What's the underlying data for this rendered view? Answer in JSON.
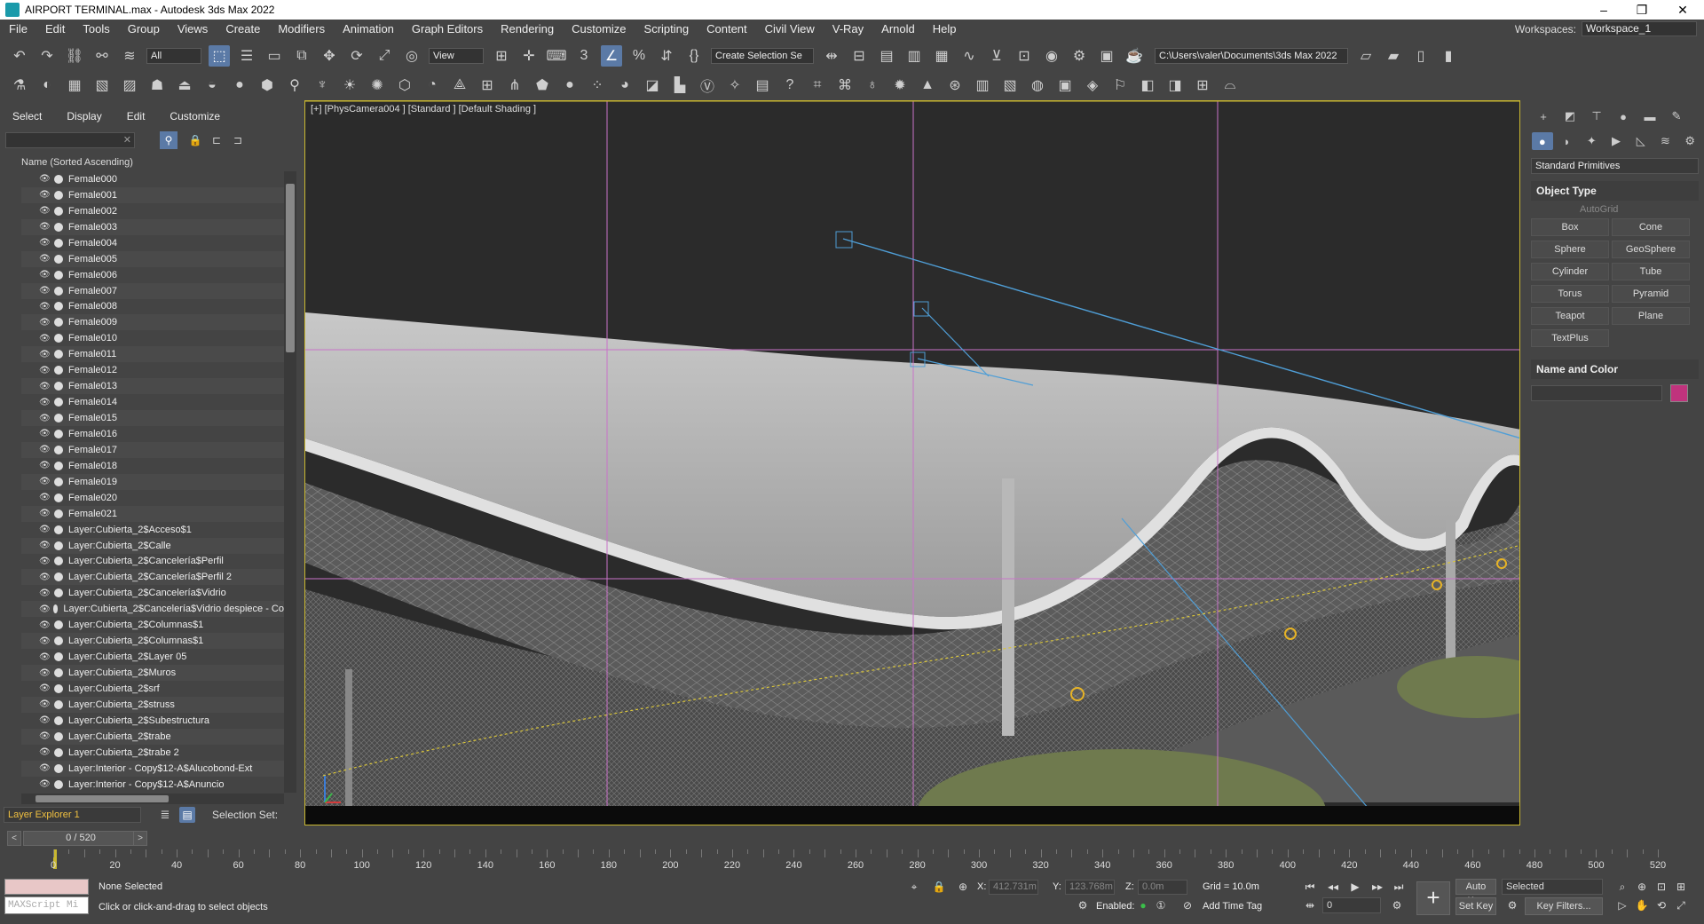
{
  "window": {
    "title": "AIRPORT TERMINAL.max - Autodesk 3ds Max 2022",
    "minimize": "–",
    "maximize": "❐",
    "close": "✕"
  },
  "menu": {
    "items": [
      "File",
      "Edit",
      "Tools",
      "Group",
      "Views",
      "Create",
      "Modifiers",
      "Animation",
      "Graph Editors",
      "Rendering",
      "Customize",
      "Scripting",
      "Content",
      "Civil View",
      "V-Ray",
      "Arnold",
      "Help"
    ],
    "workspace_label": "Workspaces:",
    "workspace_value": "Workspace_1"
  },
  "toolbar": {
    "selection_filter": "All",
    "ref_coord": "View",
    "named_selection": "Create Selection Se",
    "project_path": "C:\\Users\\valer\\Documents\\3ds Max 2022"
  },
  "scene_explorer": {
    "tabs": [
      "Select",
      "Display",
      "Edit",
      "Customize"
    ],
    "column_header": "Name (Sorted Ascending)",
    "rows": [
      "Female000",
      "Female001",
      "Female002",
      "Female003",
      "Female004",
      "Female005",
      "Female006",
      "Female007",
      "Female008",
      "Female009",
      "Female010",
      "Female011",
      "Female012",
      "Female013",
      "Female014",
      "Female015",
      "Female016",
      "Female017",
      "Female018",
      "Female019",
      "Female020",
      "Female021",
      "Layer:Cubierta_2$Acceso$1",
      "Layer:Cubierta_2$Calle",
      "Layer:Cubierta_2$Cancelería$Perfil",
      "Layer:Cubierta_2$Cancelería$Perfil 2",
      "Layer:Cubierta_2$Cancelería$Vidrio",
      "Layer:Cubierta_2$Cancelería$Vidrio despiece - Co",
      "Layer:Cubierta_2$Columnas$1",
      "Layer:Cubierta_2$Columnas$1",
      "Layer:Cubierta_2$Layer 05",
      "Layer:Cubierta_2$Muros",
      "Layer:Cubierta_2$srf",
      "Layer:Cubierta_2$struss",
      "Layer:Cubierta_2$Subestructura",
      "Layer:Cubierta_2$trabe",
      "Layer:Cubierta_2$trabe 2",
      "Layer:Interior - Copy$12-A$Alucobond-Ext",
      "Layer:Interior - Copy$12-A$Anuncio"
    ],
    "explorer_name": "Layer Explorer 1",
    "selection_set_label": "Selection Set:"
  },
  "viewport": {
    "label": "[+] [PhysCamera004 ] [Standard ] [Default Shading ]"
  },
  "command_panel": {
    "category": "Standard Primitives",
    "object_type_title": "Object Type",
    "autogrid": "AutoGrid",
    "buttons": [
      "Box",
      "Cone",
      "Sphere",
      "GeoSphere",
      "Cylinder",
      "Tube",
      "Torus",
      "Pyramid",
      "Teapot",
      "Plane",
      "TextPlus"
    ],
    "name_color_title": "Name and Color",
    "color": "#c0337d"
  },
  "timeline": {
    "frame": "0 / 520",
    "ticks": [
      "0",
      "20",
      "40",
      "60",
      "80",
      "100",
      "120",
      "140",
      "160",
      "180",
      "200",
      "220",
      "240",
      "260",
      "280",
      "300",
      "320",
      "340",
      "360",
      "380",
      "400",
      "420",
      "440",
      "460",
      "480",
      "500",
      "520"
    ]
  },
  "status": {
    "maxscript": "MAXScript Mi",
    "selection": "None Selected",
    "prompt": "Click or click-and-drag to select objects",
    "x_label": "X:",
    "x_value": "412.731m",
    "y_label": "Y:",
    "y_value": "123.768m",
    "z_label": "Z:",
    "z_value": "0.0m",
    "grid": "Grid = 10.0m",
    "enabled": "Enabled:",
    "add_time_tag": "Add Time Tag",
    "auto_key": "Auto Key",
    "set_key": "Set Key",
    "selected": "Selected",
    "key_filters": "Key Filters...",
    "frame_spinner": "0"
  }
}
